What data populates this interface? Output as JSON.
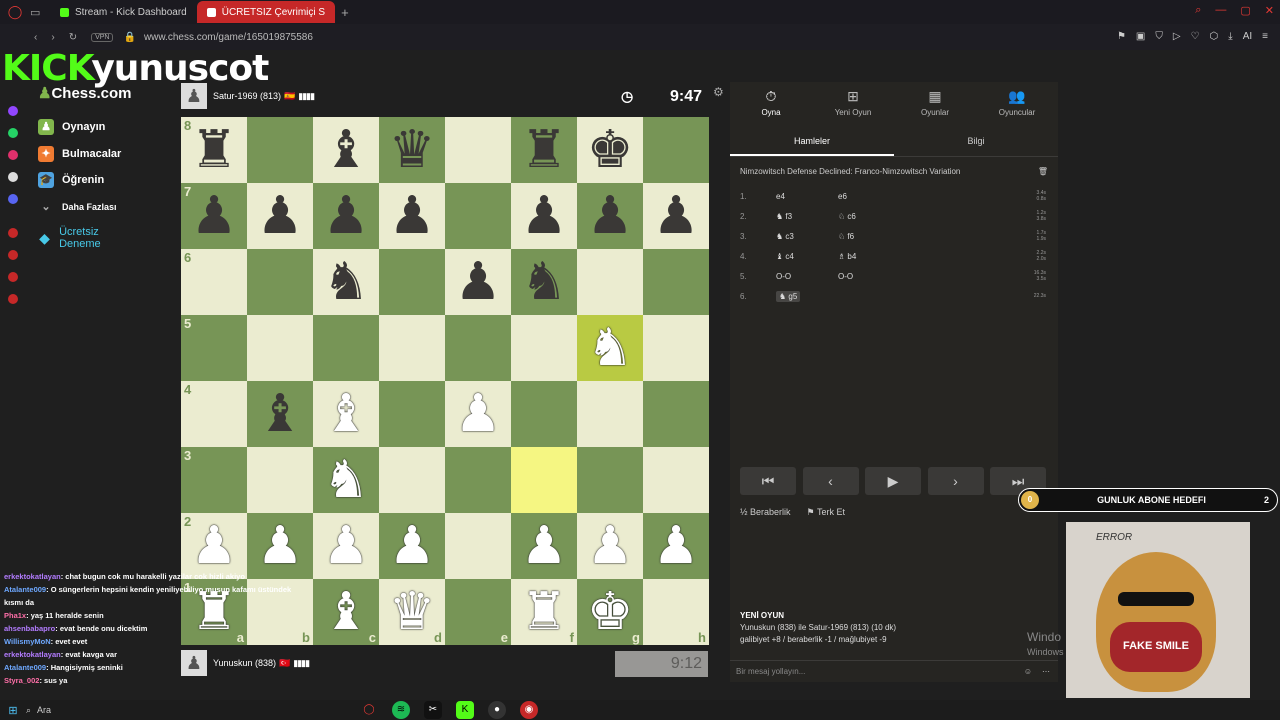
{
  "browser": {
    "tabs": [
      {
        "label": "Stream - Kick Dashboard",
        "active": false
      },
      {
        "label": "ÜCRETSIZ Çevrimiçi S",
        "active": true
      }
    ],
    "vpn": "VPN",
    "url": "www.chess.com/game/165019875586",
    "ai_label": "AI"
  },
  "overlay": {
    "kick_brand": "KICK",
    "streamer": "yunuscot",
    "sub_goal": {
      "count_badge": "0",
      "label": "GUNLUK ABONE HEDEFI",
      "target": "2"
    },
    "cam_texts": {
      "error": "ERROR",
      "shirt": "FAKE SMILE"
    },
    "windows_watermark": [
      "Windo",
      "Windows"
    ]
  },
  "sidebar": {
    "logo": "Chess.com",
    "items": [
      {
        "label": "Oynayın",
        "icon": "play-icon",
        "color": "#81b64c"
      },
      {
        "label": "Bulmacalar",
        "icon": "puzzle-icon",
        "color": "#f07b32"
      },
      {
        "label": "Öğrenin",
        "icon": "learn-icon",
        "color": "#4fa3e0"
      },
      {
        "label": "Daha Fazlası",
        "icon": "chevron-down-icon",
        "color": "#aaaaaa"
      },
      {
        "label": "Ücretsiz Deneme",
        "icon": "diamond-icon",
        "color": "#48c9e8"
      }
    ]
  },
  "players": {
    "top": {
      "name": "Satur-1969 (813)",
      "flag": "🇪🇸",
      "clock": "9:47"
    },
    "bottom": {
      "name": "Yunuskun (838)",
      "flag": "🇹🇷",
      "clock": "9:12"
    }
  },
  "board": {
    "ranks": [
      "8",
      "7",
      "6",
      "5",
      "4",
      "3",
      "2",
      "1"
    ],
    "files": [
      "a",
      "b",
      "c",
      "d",
      "e",
      "f",
      "g",
      "h"
    ],
    "position": [
      [
        "bR",
        "",
        "bB",
        "bQ",
        "",
        "bR",
        "bK",
        ""
      ],
      [
        "bP",
        "bP",
        "bP",
        "bP",
        "",
        "bP",
        "bP",
        "bP"
      ],
      [
        "",
        "",
        "bN",
        "",
        "bP",
        "bN",
        "",
        ""
      ],
      [
        "",
        "",
        "",
        "",
        "",
        "",
        "wN",
        ""
      ],
      [
        "",
        "bB",
        "wB",
        "",
        "wP",
        "",
        "",
        ""
      ],
      [
        "",
        "",
        "wN",
        "",
        "",
        "",
        "",
        ""
      ],
      [
        "wP",
        "wP",
        "wP",
        "wP",
        "",
        "wP",
        "wP",
        "wP"
      ],
      [
        "wR",
        "",
        "wB",
        "wQ",
        "",
        "wR",
        "wK",
        ""
      ]
    ],
    "highlight": [
      "f3",
      "g5"
    ]
  },
  "panel": {
    "tabs": [
      {
        "label": "Oyna",
        "icon": "clock-icon",
        "active": true
      },
      {
        "label": "Yeni Oyun",
        "icon": "plus-icon",
        "active": false
      },
      {
        "label": "Oyunlar",
        "icon": "board-icon",
        "active": false
      },
      {
        "label": "Oyuncular",
        "icon": "players-icon",
        "active": false
      }
    ],
    "subtabs": [
      {
        "label": "Hamleler",
        "active": true
      },
      {
        "label": "Bilgi",
        "active": false
      }
    ],
    "opening": "Nimzowitsch Defense Declined: Franco-Nimzowitsch Variation",
    "moves": [
      {
        "num": "1.",
        "white": "e4",
        "black": "e6",
        "times": [
          "3.4s",
          "0.8s"
        ]
      },
      {
        "num": "2.",
        "white": "♞ f3",
        "black": "♘ c6",
        "times": [
          "1.2s",
          "3.8s"
        ]
      },
      {
        "num": "3.",
        "white": "♞ c3",
        "black": "♘ f6",
        "times": [
          "1.7s",
          "1.9s"
        ]
      },
      {
        "num": "4.",
        "white": "♝ c4",
        "black": "♗ b4",
        "times": [
          "2.2s",
          "2.0s"
        ]
      },
      {
        "num": "5.",
        "white": "O-O",
        "black": "O-O",
        "times": [
          "16.3s",
          "3.5s"
        ]
      },
      {
        "num": "6.",
        "white": "♞ g5",
        "black": "",
        "times": [
          "22.3s"
        ]
      }
    ],
    "nav": [
      "⏮",
      "‹",
      "▶",
      "›",
      "⏭"
    ],
    "draw": "Beraberlik",
    "resign": "Terk Et",
    "new_game_title": "YENİ OYUN",
    "new_game_line1": "Yunuskun (838) ile Satur-1969 (813) (10 dk)",
    "new_game_line2": "galibiyet +8 / beraberlik -1 / mağlubiyet -9",
    "message_placeholder": "Bir mesaj yollayın..."
  },
  "chat": [
    {
      "user": "erkektokatlayan",
      "text": ": chat bugun cok mu harakelli yazilar cok hizli akiyo"
    },
    {
      "user": "Atalante009",
      "text": ": O süngerlerin hepsini kendin yeniliyebiliyo musun kafamı üstündek"
    },
    {
      "user": "",
      "text": "kısmı da"
    },
    {
      "user": "Pha1x",
      "text": ": yaş 11 heralde senin"
    },
    {
      "user": "ahsenbabapro",
      "text": ": evat bende onu dicektim"
    },
    {
      "user": "WillismyMoN",
      "text": ": evet evet"
    },
    {
      "user": "erkektokatlayan",
      "text": ": evat kavga var"
    },
    {
      "user": "Atalante009",
      "text": ": Hangisiymiş seninki"
    },
    {
      "user": "Styra_002",
      "text": ": sus ya"
    }
  ],
  "taskbar": {
    "search": "Ara"
  }
}
